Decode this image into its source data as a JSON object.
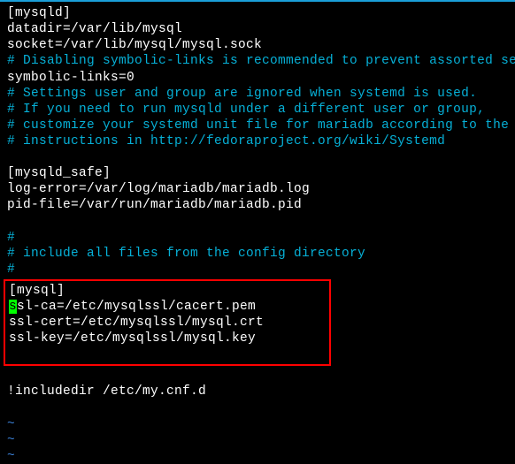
{
  "lines": {
    "l1": "[mysqld]",
    "l2": "datadir=/var/lib/mysql",
    "l3": "socket=/var/lib/mysql/mysql.sock",
    "l4": "# Disabling symbolic-links is recommended to prevent assorted secu",
    "l5": "symbolic-links=0",
    "l6": "# Settings user and group are ignored when systemd is used.",
    "l7": "# If you need to run mysqld under a different user or group,",
    "l8": "# customize your systemd unit file for mariadb according to the",
    "l9": "# instructions in http://fedoraproject.org/wiki/Systemd",
    "l10": "",
    "l11": "[mysqld_safe]",
    "l12": "log-error=/var/log/mariadb/mariadb.log",
    "l13": "pid-file=/var/run/mariadb/mariadb.pid",
    "l14": "",
    "l15": "#",
    "l16": "# include all files from the config directory",
    "l17": "#",
    "l18": "[mysql]",
    "l19a": "s",
    "l19b": "sl-ca=/etc/mysqlssl/cacert.pem",
    "l20": "ssl-cert=/etc/mysqlssl/mysql.crt",
    "l21": "ssl-key=/etc/mysqlssl/mysql.key",
    "l22": "",
    "l23": "",
    "l24": "!includedir /etc/my.cnf.d",
    "tilde": "~"
  }
}
